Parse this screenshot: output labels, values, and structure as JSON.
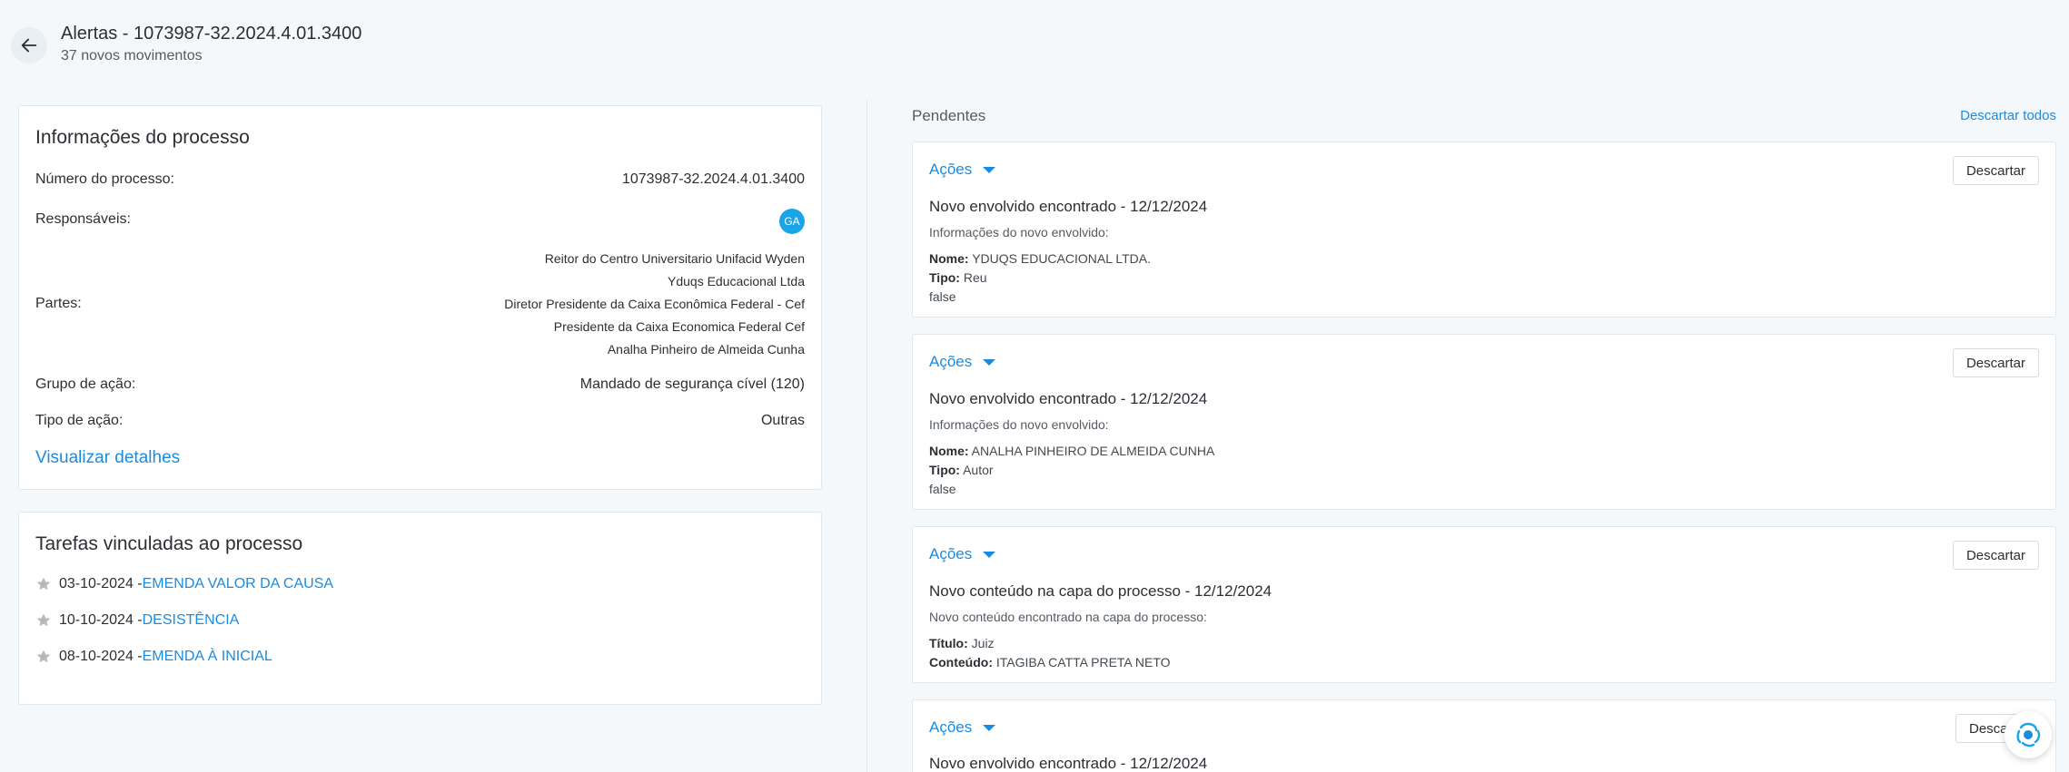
{
  "header": {
    "title": "Alertas - 1073987-32.2024.4.01.3400",
    "subtitle": "37 novos movimentos"
  },
  "process_info": {
    "title": "Informações do processo",
    "rows": {
      "numero_label": "Número do processo:",
      "numero_value": "1073987-32.2024.4.01.3400",
      "responsaveis_label": "Responsáveis:",
      "responsaveis_avatar": "GA",
      "partes_label": "Partes:",
      "partes": [
        "Reitor do Centro Universitario Unifacid Wyden",
        "Yduqs Educacional Ltda",
        "Diretor Presidente da Caixa Econômica Federal - Cef",
        "Presidente da Caixa Economica Federal Cef",
        "Analha Pinheiro de Almeida Cunha"
      ],
      "grupo_label": "Grupo de ação:",
      "grupo_value": "Mandado de segurança cível (120)",
      "tipo_label": "Tipo de ação:",
      "tipo_value": "Outras"
    },
    "details_link": "Visualizar detalhes"
  },
  "tasks": {
    "title": "Tarefas vinculadas ao processo",
    "items": [
      {
        "date": "03-10-2024 - ",
        "title": "EMENDA VALOR DA CAUSA"
      },
      {
        "date": "10-10-2024 - ",
        "title": "DESISTÊNCIA"
      },
      {
        "date": "08-10-2024 - ",
        "title": "EMENDA À INICIAL"
      }
    ]
  },
  "pending": {
    "title": "Pendentes",
    "discard_all": "Descartar todos",
    "actions_label": "Ações",
    "discard_label": "Descartar",
    "alerts": [
      {
        "title": "Novo envolvido encontrado - 12/12/2024",
        "description": "Informações do novo envolvido:",
        "line1_label": "Nome:",
        "line1_value": " YDUQS EDUCACIONAL LTDA.",
        "line2_label": "Tipo:",
        "line2_value": " Reu",
        "line3": "false"
      },
      {
        "title": "Novo envolvido encontrado - 12/12/2024",
        "description": "Informações do novo envolvido:",
        "line1_label": "Nome:",
        "line1_value": " ANALHA PINHEIRO DE ALMEIDA CUNHA",
        "line2_label": "Tipo:",
        "line2_value": " Autor",
        "line3": "false"
      },
      {
        "title": "Novo conteúdo na capa do processo - 12/12/2024",
        "description": "Novo conteúdo encontrado na capa do processo:",
        "line1_label": "Título:",
        "line1_value": " Juiz",
        "line2_label": "Conteúdo:",
        "line2_value": " ITAGIBA CATTA PRETA NETO"
      },
      {
        "title": "Novo envolvido encontrado - 12/12/2024",
        "discard_partial": "Desca"
      }
    ]
  },
  "colors": {
    "accent": "#1b8be0",
    "avatar": "#1ba5e8",
    "background": "#f5f8fb"
  },
  "icons": {
    "back": "arrow-left-icon",
    "task": "star-icon",
    "actions": "caret-down-icon",
    "assistant": "assistant-logo-icon"
  }
}
